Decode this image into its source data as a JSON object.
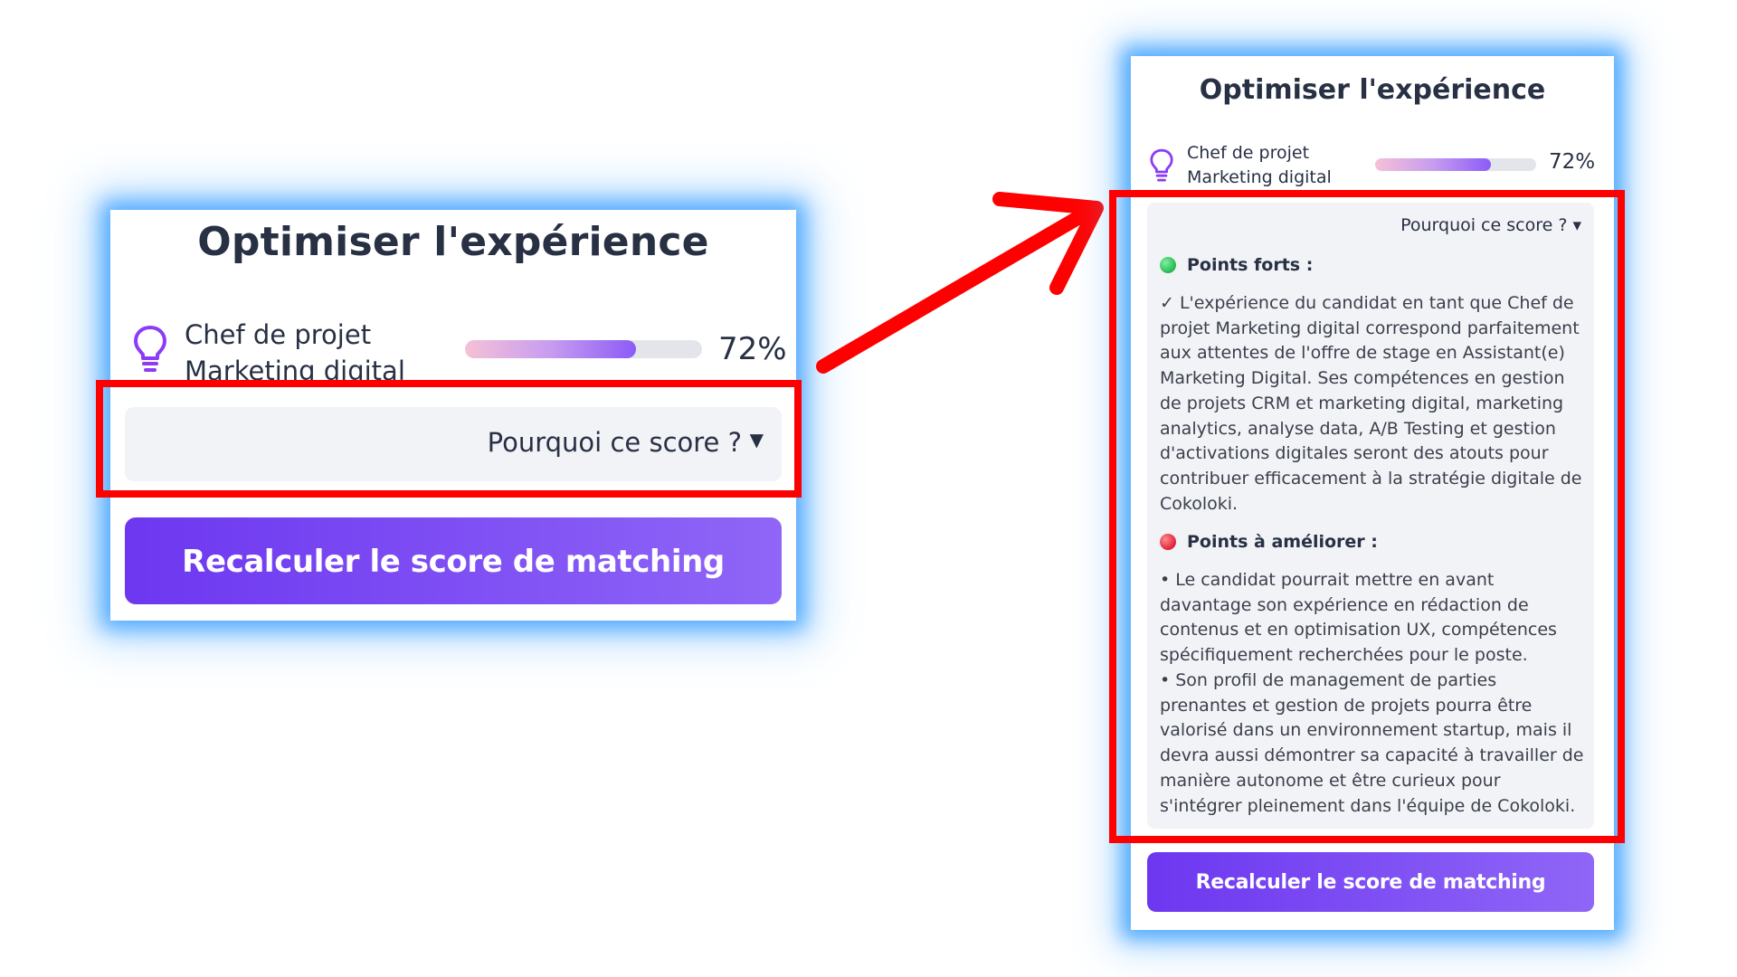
{
  "before": {
    "title": "Optimiser l'expérience",
    "job_title": "Chef de projet Marketing digital",
    "score_percent_label": "72%",
    "score_fraction": 0.72,
    "why_label": "Pourquoi ce score ?",
    "why_caret": "▼",
    "recalc_button": "Recalculer le score de matching"
  },
  "after": {
    "title": "Optimiser l'expérience",
    "job_title": "Chef de projet Marketing digital",
    "score_percent_label": "72%",
    "score_fraction": 0.72,
    "why_label": "Pourquoi ce score ?",
    "why_caret": "▾",
    "strengths_title": "Points forts :",
    "strengths_text": "✓ L'expérience du candidat en tant que Chef de projet Marketing digital correspond parfaitement aux attentes de l'offre de stage en Assistant(e) Marketing Digital. Ses compétences en gestion de projets CRM et marketing digital, marketing analytics, analyse data, A/B Testing et gestion d'activations digitales seront des atouts pour contribuer efficacement à la stratégie digitale de Cokoloki.",
    "improve_title": "Points à améliorer :",
    "improve_item_1": "• Le candidat pourrait mettre en avant davantage son expérience en rédaction de contenus et en optimisation UX, compétences spécifiquement recherchées pour le poste.",
    "improve_item_2": "• Son profil de management de parties prenantes et gestion de projets pourra être valorisé dans un environnement startup, mais il devra aussi démontrer sa capacité à travailler de manière autonome et être curieux pour s'intégrer pleinement dans l'équipe de Cokoloki.",
    "recalc_button": "Recalculer le score de matching"
  },
  "colors": {
    "highlight": "#ff0000",
    "accent": "#7c4dff",
    "glow": "#3ca0ff",
    "strength_dot": "#28b64f",
    "improve_dot": "#e0223a"
  },
  "icons": {
    "job": "lightbulb-icon",
    "strengths": "green-circle-icon",
    "improve": "red-circle-icon"
  }
}
